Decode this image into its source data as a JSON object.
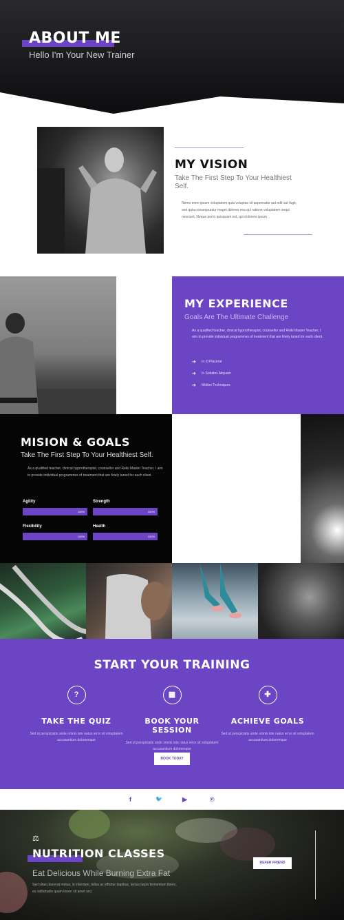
{
  "hero": {
    "title": "ABOUT ME",
    "subtitle": "Hello I'm Your New Trainer"
  },
  "vision": {
    "title": "MY VISION",
    "subtitle": "Take The First Step To Your Healthiest Self.",
    "text": "Nemo enim ipsam voluptatem quia voluptas sit aspernatur aut odit aut fugit, sed quia consequuntur magni dolores eos qui ratione voluptatem sequi nesciunt. Neque porro quisquam est, qui dolorem ipsum"
  },
  "experience": {
    "title": "MY EXPERIENCE",
    "subtitle": "Goals Are The Ultimate Challenge",
    "text": "As a qualified teacher, clinical hypnotherapist, counsellor and Reiki Master Teacher, I aim to provide individual programmes of treatment that are finely tuned for each client.",
    "items": [
      "In Id Placerat",
      "In Sodales Aliquam",
      "Motion Techniques"
    ]
  },
  "mission": {
    "title": "MISION & GOALS",
    "subtitle": "Take The First Step To Your Healthiest Self.",
    "text": "As a qualified teacher, clinical hypnotherapist, counsellor and Reiki Master Teacher, I aim to provide individual programmes of treatment that are finely tuned for each client.",
    "skills": [
      {
        "label": "Agility",
        "value": "100%"
      },
      {
        "label": "Strength",
        "value": "100%"
      },
      {
        "label": "Flexibility",
        "value": "100%"
      },
      {
        "label": "Health",
        "value": "100%"
      }
    ]
  },
  "training": {
    "title": "START YOUR TRAINING",
    "columns": [
      {
        "icon": "question-icon",
        "glyph": "?",
        "title": "TAKE THE QUIZ",
        "text": "Sed ut perspiciatis unde omnis iste natus error sit voluptatem accusantium doloremque"
      },
      {
        "icon": "calendar-icon",
        "glyph": "▦",
        "title": "BOOK YOUR SESSION",
        "text": "Sed ut perspiciatis unde omnis iste natus error sit voluptatem accusantium doloremque"
      },
      {
        "icon": "puzzle-icon",
        "glyph": "✚",
        "title": "ACHIEVE GOALS",
        "text": "Sed ut perspiciatis unde omnis iste natus error sit voluptatem accusantium doloremque"
      }
    ],
    "button": "BOOK TODAY"
  },
  "social": {
    "items": [
      {
        "icon": "facebook-icon",
        "glyph": "f"
      },
      {
        "icon": "twitter-icon",
        "glyph": "🐦"
      },
      {
        "icon": "youtube-icon",
        "glyph": "▶"
      },
      {
        "icon": "pinterest-icon",
        "glyph": "℗"
      }
    ]
  },
  "nutrition": {
    "title": "NUTRITION CLASSES",
    "subtitle": "Eat Delicious While Burning Extra Fat",
    "text": "Sed vitae placerat metus, in interdum, tellus ac efficitur dapibus, lectus turpis fermentum libero, eu sollicitudin quam lorem sit amet orci.",
    "button": "REFER FRIEND"
  },
  "colors": {
    "accent": "#6b45c4",
    "dark": "#0c0c0e"
  }
}
